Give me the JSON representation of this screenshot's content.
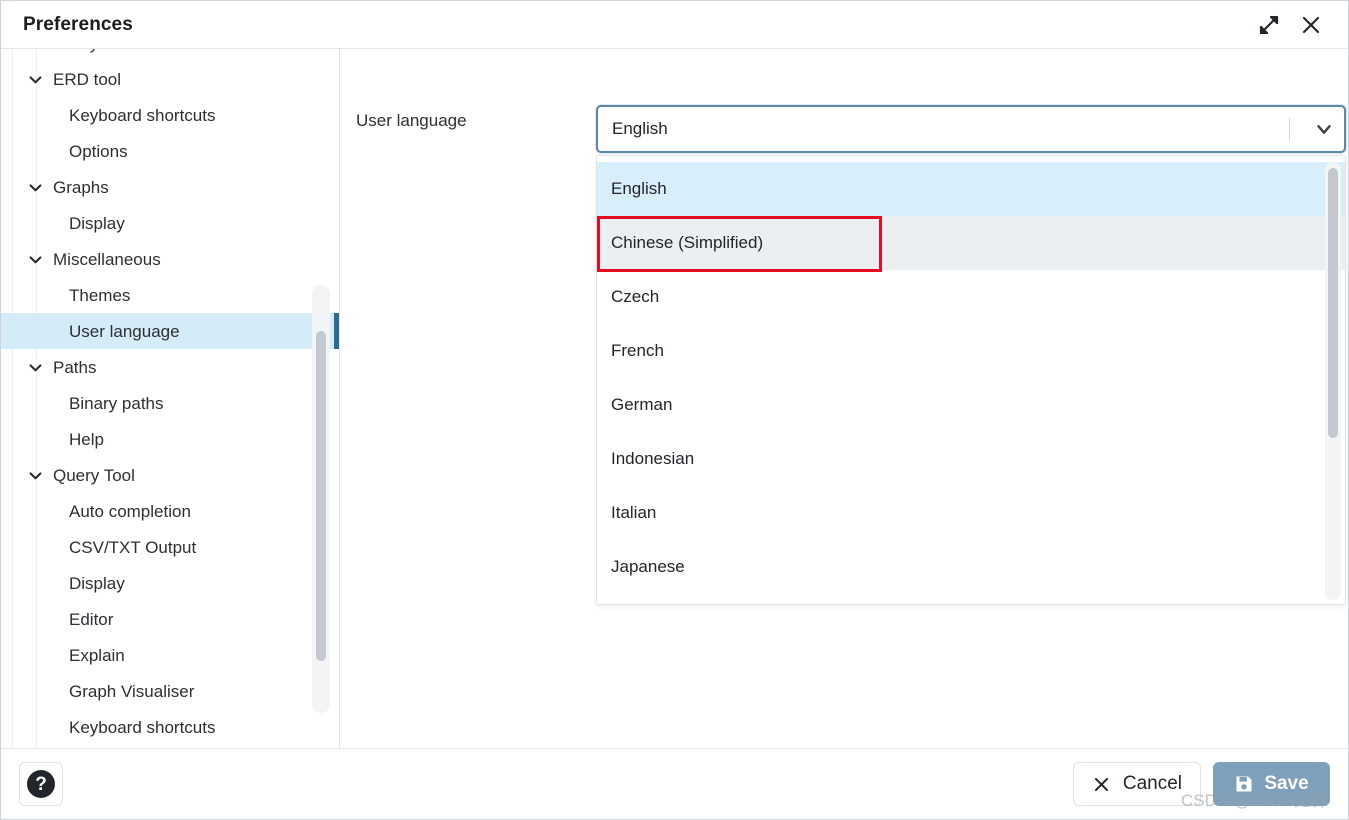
{
  "window": {
    "title": "Preferences",
    "expand_icon": "expand-diagonal-icon",
    "close_icon": "close-icon"
  },
  "sidebar": {
    "items": [
      {
        "label": "Keyboard shortcuts",
        "level": 1,
        "expandable": false,
        "selected": false,
        "clipped": true
      },
      {
        "label": "ERD tool",
        "level": 0,
        "expandable": true,
        "selected": false
      },
      {
        "label": "Keyboard shortcuts",
        "level": 1,
        "expandable": false,
        "selected": false
      },
      {
        "label": "Options",
        "level": 1,
        "expandable": false,
        "selected": false
      },
      {
        "label": "Graphs",
        "level": 0,
        "expandable": true,
        "selected": false
      },
      {
        "label": "Display",
        "level": 1,
        "expandable": false,
        "selected": false
      },
      {
        "label": "Miscellaneous",
        "level": 0,
        "expandable": true,
        "selected": false
      },
      {
        "label": "Themes",
        "level": 1,
        "expandable": false,
        "selected": false
      },
      {
        "label": "User language",
        "level": 1,
        "expandable": false,
        "selected": true
      },
      {
        "label": "Paths",
        "level": 0,
        "expandable": true,
        "selected": false
      },
      {
        "label": "Binary paths",
        "level": 1,
        "expandable": false,
        "selected": false
      },
      {
        "label": "Help",
        "level": 1,
        "expandable": false,
        "selected": false
      },
      {
        "label": "Query Tool",
        "level": 0,
        "expandable": true,
        "selected": false
      },
      {
        "label": "Auto completion",
        "level": 1,
        "expandable": false,
        "selected": false
      },
      {
        "label": "CSV/TXT Output",
        "level": 1,
        "expandable": false,
        "selected": false
      },
      {
        "label": "Display",
        "level": 1,
        "expandable": false,
        "selected": false
      },
      {
        "label": "Editor",
        "level": 1,
        "expandable": false,
        "selected": false
      },
      {
        "label": "Explain",
        "level": 1,
        "expandable": false,
        "selected": false
      },
      {
        "label": "Graph Visualiser",
        "level": 1,
        "expandable": false,
        "selected": false
      },
      {
        "label": "Keyboard shortcuts",
        "level": 1,
        "expandable": false,
        "selected": false
      }
    ]
  },
  "main": {
    "field_label": "User language",
    "select": {
      "value": "English",
      "arrow_icon": "chevron-down-icon",
      "open": true
    },
    "options": [
      {
        "label": "English",
        "state": "selected"
      },
      {
        "label": "Chinese (Simplified)",
        "state": "hovered"
      },
      {
        "label": "Czech",
        "state": "normal"
      },
      {
        "label": "French",
        "state": "normal"
      },
      {
        "label": "German",
        "state": "normal"
      },
      {
        "label": "Indonesian",
        "state": "normal"
      },
      {
        "label": "Italian",
        "state": "normal"
      },
      {
        "label": "Japanese",
        "state": "normal"
      }
    ]
  },
  "footer": {
    "help_label": "?",
    "cancel_label": "Cancel",
    "save_label": "Save"
  },
  "watermark": {
    "text": "CSDN @DATA无界"
  },
  "colors": {
    "selected_row_bg": "#d4ebf8",
    "selected_row_indicator": "#2c6b96",
    "option_selected_bg": "#d9eefb",
    "option_hover_bg": "#eceff2",
    "focus_border": "#5b87a8",
    "annotation_red": "#e60c20",
    "save_button_bg": "#7fa0bb",
    "scrollbar_thumb": "#c3c8d1"
  }
}
